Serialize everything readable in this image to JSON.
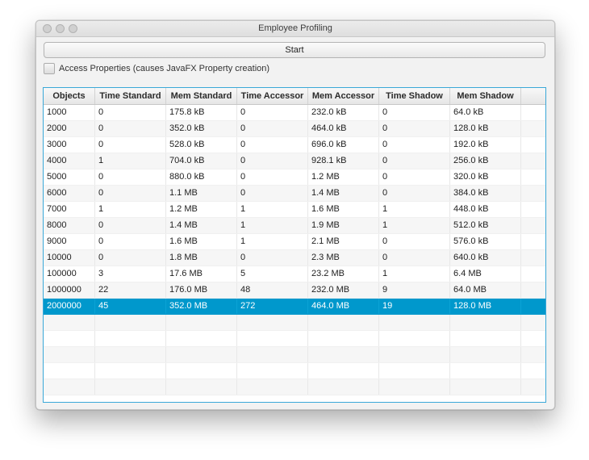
{
  "window": {
    "title": "Employee Profiling"
  },
  "controls": {
    "start_label": "Start",
    "access_checkbox_label": "Access Properties (causes JavaFX Property creation)",
    "access_checked": false
  },
  "table": {
    "columns": [
      "Objects",
      "Time Standard",
      "Mem Standard",
      "Time Accessor",
      "Mem Accessor",
      "Time Shadow",
      "Mem Shadow"
    ],
    "rows": [
      [
        "1000",
        "0",
        "175.8 kB",
        "0",
        "232.0 kB",
        "0",
        "64.0 kB"
      ],
      [
        "2000",
        "0",
        "352.0 kB",
        "0",
        "464.0 kB",
        "0",
        "128.0 kB"
      ],
      [
        "3000",
        "0",
        "528.0 kB",
        "0",
        "696.0 kB",
        "0",
        "192.0 kB"
      ],
      [
        "4000",
        "1",
        "704.0 kB",
        "0",
        "928.1 kB",
        "0",
        "256.0 kB"
      ],
      [
        "5000",
        "0",
        "880.0 kB",
        "0",
        "1.2 MB",
        "0",
        "320.0 kB"
      ],
      [
        "6000",
        "0",
        "1.1 MB",
        "0",
        "1.4 MB",
        "0",
        "384.0 kB"
      ],
      [
        "7000",
        "1",
        "1.2 MB",
        "1",
        "1.6 MB",
        "1",
        "448.0 kB"
      ],
      [
        "8000",
        "0",
        "1.4 MB",
        "1",
        "1.9 MB",
        "1",
        "512.0 kB"
      ],
      [
        "9000",
        "0",
        "1.6 MB",
        "1",
        "2.1 MB",
        "0",
        "576.0 kB"
      ],
      [
        "10000",
        "0",
        "1.8 MB",
        "0",
        "2.3 MB",
        "0",
        "640.0 kB"
      ],
      [
        "100000",
        "3",
        "17.6 MB",
        "5",
        "23.2 MB",
        "1",
        "6.4 MB"
      ],
      [
        "1000000",
        "22",
        "176.0 MB",
        "48",
        "232.0 MB",
        "9",
        "64.0 MB"
      ],
      [
        "2000000",
        "45",
        "352.0 MB",
        "272",
        "464.0 MB",
        "19",
        "128.0 MB"
      ]
    ],
    "selected_row": 12,
    "empty_rows": 5
  },
  "colors": {
    "selection": "#0098cc",
    "focus_border": "#3aa8d8"
  }
}
